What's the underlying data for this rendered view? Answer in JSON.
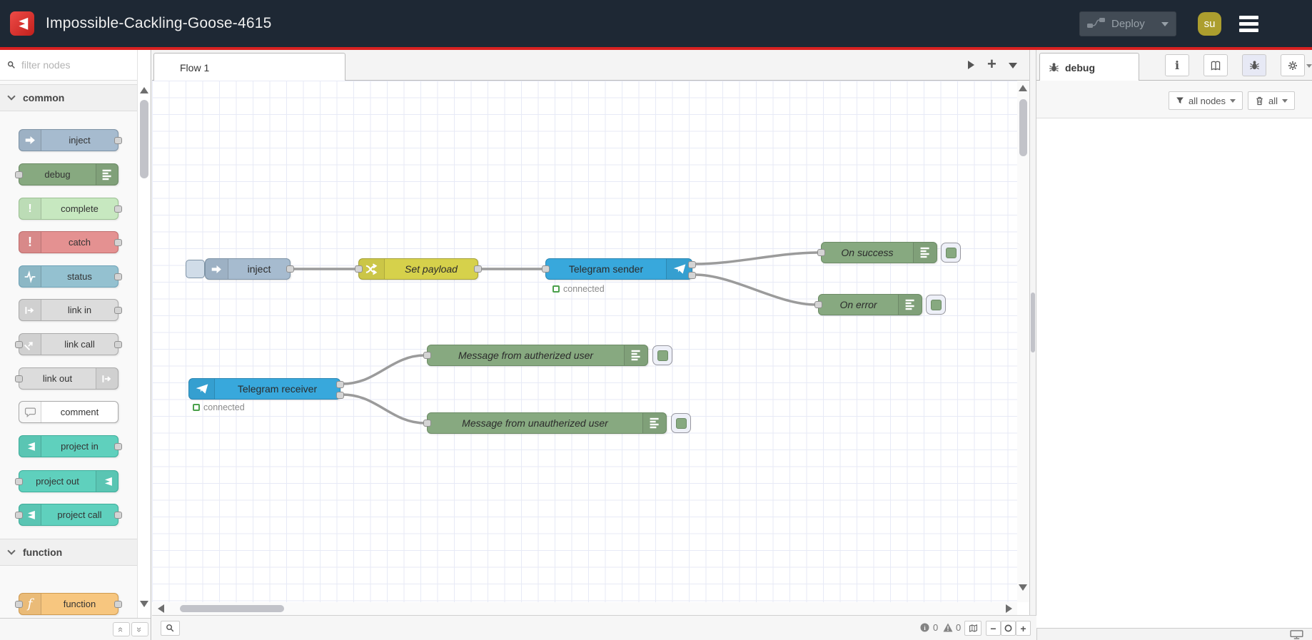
{
  "header": {
    "title": "Impossible-Cackling-Goose-4615",
    "deploy_label": "Deploy",
    "avatar_initials": "su"
  },
  "palette": {
    "filter_placeholder": "filter nodes",
    "sections": [
      {
        "label": "common",
        "items": [
          {
            "label": "inject"
          },
          {
            "label": "debug"
          },
          {
            "label": "complete"
          },
          {
            "label": "catch"
          },
          {
            "label": "status"
          },
          {
            "label": "link in"
          },
          {
            "label": "link call"
          },
          {
            "label": "link out"
          },
          {
            "label": "comment"
          },
          {
            "label": "project in"
          },
          {
            "label": "project out"
          },
          {
            "label": "project call"
          }
        ]
      },
      {
        "label": "function",
        "items": [
          {
            "label": "function"
          }
        ]
      }
    ]
  },
  "workspace": {
    "tab_label": "Flow 1",
    "nodes": [
      {
        "label": "inject"
      },
      {
        "label": "Set payload"
      },
      {
        "label": "Telegram sender",
        "status": "connected"
      },
      {
        "label": "On success"
      },
      {
        "label": "On error"
      },
      {
        "label": "Telegram receiver",
        "status": "connected"
      },
      {
        "label": "Message from autherized user"
      },
      {
        "label": "Message from unautherized user"
      }
    ],
    "footer": {
      "info_count": "0",
      "warning_count": "0"
    }
  },
  "sidebar": {
    "tab_label": "debug",
    "filter_button": "all nodes",
    "clear_button": "all"
  },
  "colors": {
    "header_bg": "#1e2834",
    "accent_red": "#d92121",
    "node_inject": "#a6bbcf",
    "node_change": "#d6d14b",
    "node_telegram": "#38a8dc",
    "node_debug": "#87a980",
    "node_complete": "#c7e8c0",
    "node_catch": "#e49191",
    "node_status": "#94c1d0",
    "node_link": "#dcdcdc",
    "node_project": "#5fd0bd",
    "node_function": "#f7c67f",
    "status_ok_green": "#4ba04b",
    "avatar_bg": "#ac9e2e"
  }
}
